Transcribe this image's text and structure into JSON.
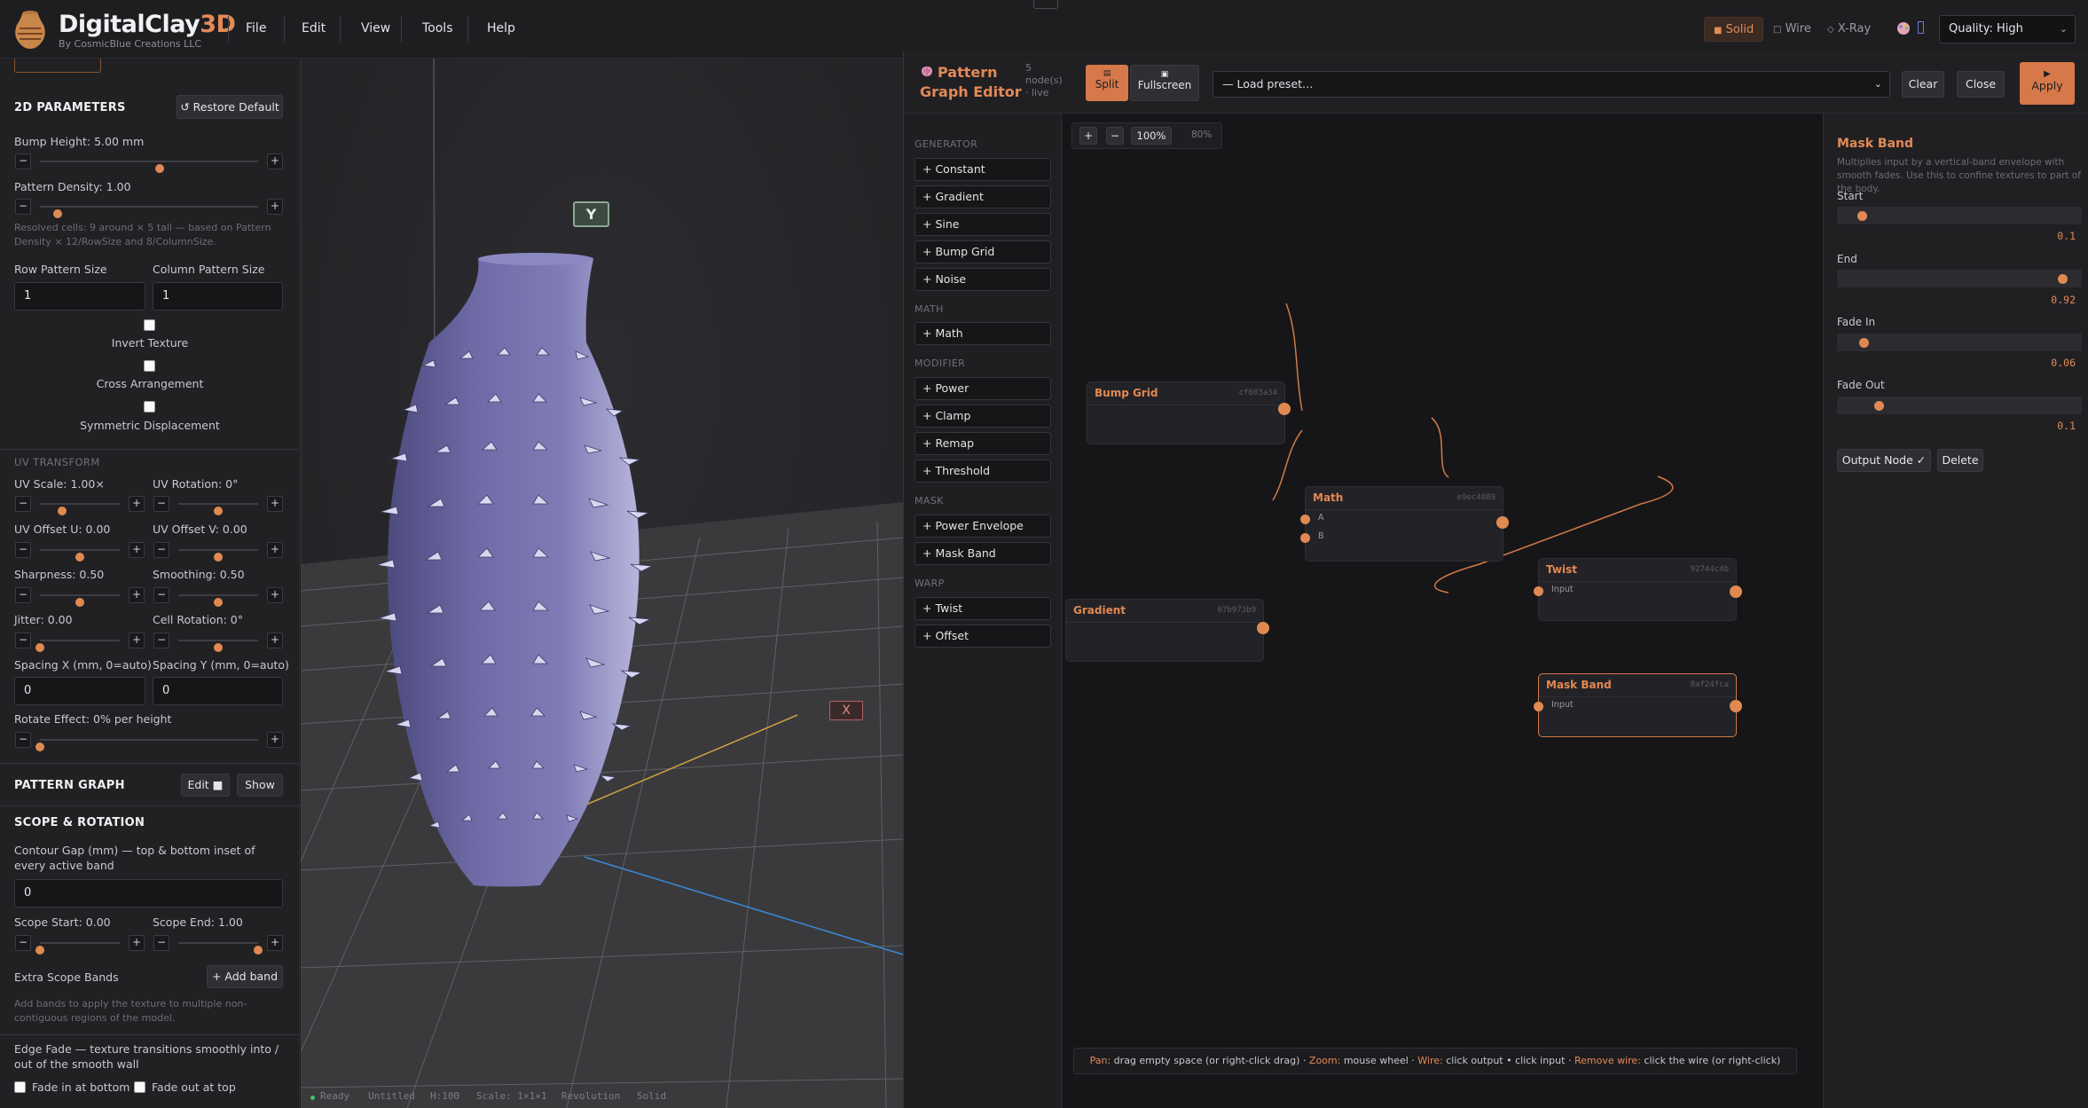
{
  "app": {
    "brand_main": "DigitalClay",
    "brand_accent": "3D",
    "brand_sub": "By CosmicBlue Creations LLC",
    "menus": [
      "File",
      "Edit",
      "View",
      "Tools",
      "Help"
    ],
    "render_modes": [
      {
        "label": "Solid",
        "glyph": "■",
        "active": true
      },
      {
        "label": "Wire",
        "glyph": "□",
        "active": false
      },
      {
        "label": "X-Ray",
        "glyph": "◇",
        "active": false
      }
    ],
    "quality": "Quality: High",
    "accent_color": "#e38a56"
  },
  "left": {
    "params_title": "2D PARAMETERS",
    "restore_label": "↺ Restore Default",
    "bump_height": {
      "label": "Bump Height: 5.00 mm",
      "fraction": 0.55
    },
    "pattern_density": {
      "label": "Pattern Density: 1.00",
      "fraction": 0.08
    },
    "resolved_note": "Resolved cells: 9 around × 5 tall — based on Pattern Density × 12/RowSize and 8/ColumnSize.",
    "row_size_label": "Row Pattern Size",
    "row_size": "1",
    "col_size_label": "Column Pattern Size",
    "col_size": "1",
    "invert_texture": "Invert Texture",
    "cross_arrangement": "Cross Arrangement",
    "symmetric_displacement": "Symmetric Displacement",
    "uv_title": "UV TRANSFORM",
    "uv_scale": {
      "label": "UV Scale: 1.00×",
      "fraction": 0.28
    },
    "uv_rotation": {
      "label": "UV Rotation: 0°",
      "fraction": 0.5
    },
    "uv_offset_u": {
      "label": "UV Offset U: 0.00",
      "fraction": 0.5
    },
    "uv_offset_v": {
      "label": "UV Offset V: 0.00",
      "fraction": 0.5
    },
    "sharpness": {
      "label": "Sharpness: 0.50",
      "fraction": 0.5
    },
    "smoothing": {
      "label": "Smoothing: 0.50",
      "fraction": 0.5
    },
    "jitter": {
      "label": "Jitter: 0.00",
      "fraction": 0.0
    },
    "cell_rotation": {
      "label": "Cell Rotation: 0°",
      "fraction": 0.5
    },
    "spacing_x_label": "Spacing X (mm, 0=auto)",
    "spacing_x": "0",
    "spacing_y_label": "Spacing Y (mm, 0=auto)",
    "spacing_y": "0",
    "rotate_effect": {
      "label": "Rotate Effect: 0% per height",
      "fraction": 0.0
    },
    "pattern_graph_title": "PATTERN GRAPH",
    "edit_label": "Edit ■",
    "show_label": "Show",
    "scope_title": "SCOPE & ROTATION",
    "contour_gap_label": "Contour Gap (mm) — top & bottom inset of every active band",
    "contour_gap": "0",
    "scope_start": {
      "label": "Scope Start: 0.00",
      "fraction": 0.0
    },
    "scope_end": {
      "label": "Scope End: 1.00",
      "fraction": 1.0
    },
    "extra_bands_label": "Extra Scope Bands",
    "add_band_label": "+ Add band",
    "extra_bands_note": "Add bands to apply the texture to multiple non-contiguous regions of the model.",
    "edge_fade_label": "Edge Fade — texture transitions smoothly into / out of the smooth wall",
    "fade_in_bottom": "Fade in at bottom",
    "fade_out_top": "Fade out at top"
  },
  "viewport": {
    "y_axis_label": "Y",
    "x_axis_label": "X",
    "status": {
      "ready": "Ready",
      "file": "Untitled",
      "height": "H:100",
      "scale": "Scale: 1×1×1",
      "mode": "Revolution",
      "render": "Solid"
    }
  },
  "editor": {
    "title_line1": "Pattern",
    "title_line2": "Graph Editor",
    "node_count_line1": "5",
    "node_count_line2": "node(s)",
    "node_count_line3": "· live",
    "split_label": "Split",
    "fullscreen_label": "Fullscreen",
    "preset_placeholder": "— Load preset…",
    "clear_label": "Clear",
    "close_label": "Close",
    "apply_label": "Apply",
    "palette": [
      {
        "head": "GENERATOR",
        "items": [
          "+ Constant",
          "+ Gradient",
          "+ Sine",
          "+ Bump Grid",
          "+ Noise"
        ]
      },
      {
        "head": "MATH",
        "items": [
          "+ Math"
        ]
      },
      {
        "head": "MODIFIER",
        "items": [
          "+ Power",
          "+ Clamp",
          "+ Remap",
          "+ Threshold"
        ]
      },
      {
        "head": "MASK",
        "items": [
          "+ Power Envelope",
          "+ Mask Band"
        ]
      },
      {
        "head": "WARP",
        "items": [
          "+ Twist",
          "+ Offset"
        ]
      }
    ],
    "zoom": {
      "plus": "+",
      "minus": "−",
      "zoom_value": "100%",
      "secondary": "80%"
    },
    "nodes": {
      "bump_grid": {
        "title": "Bump Grid",
        "id": "cf603a34"
      },
      "math": {
        "title": "Math",
        "id": "e9ec4889",
        "in_a": "A",
        "in_b": "B"
      },
      "gradient": {
        "title": "Gradient",
        "id": "67b973b9"
      },
      "twist": {
        "title": "Twist",
        "id": "92744c4b",
        "in": "Input"
      },
      "mask_band": {
        "title": "Mask Band",
        "id": "8af24fca",
        "in": "Input"
      }
    },
    "help": {
      "pan_k": "Pan:",
      "pan_v": " drag empty space (or right-click drag) · ",
      "zoom_k": "Zoom:",
      "zoom_v": " mouse wheel · ",
      "wire_k": "Wire:",
      "wire_v": " click output  •  click input · ",
      "rm_k": "Remove wire:",
      "rm_v": " click the wire (or right-click)"
    },
    "inspector": {
      "title": "Mask Band",
      "desc": "Multiplies input by a vertical-band envelope with smooth fades. Use this to confine textures to part of the body.",
      "start": {
        "label": "Start",
        "value": "0.1",
        "fraction": 0.1
      },
      "end": {
        "label": "End",
        "value": "0.92",
        "fraction": 0.92
      },
      "fade_in": {
        "label": "Fade In",
        "value": "0.06",
        "fraction": 0.11
      },
      "fade_out": {
        "label": "Fade Out",
        "value": "0.1",
        "fraction": 0.17
      },
      "output_node_label": "Output Node ✓",
      "delete_label": "Delete"
    }
  }
}
